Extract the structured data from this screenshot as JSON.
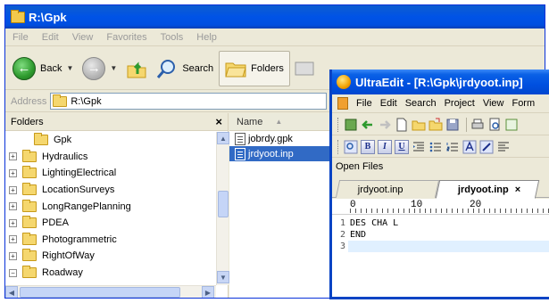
{
  "explorer": {
    "title": "R:\\Gpk",
    "menu": [
      "File",
      "Edit",
      "View",
      "Favorites",
      "Tools",
      "Help"
    ],
    "toolbar": {
      "back_label": "Back",
      "search_label": "Search",
      "folders_label": "Folders"
    },
    "address": {
      "label": "Address",
      "value": "R:\\Gpk"
    },
    "folders_pane": {
      "title": "Folders",
      "close": "×",
      "items": [
        {
          "label": "Gpk",
          "expander": ""
        },
        {
          "label": "Hydraulics",
          "expander": "+"
        },
        {
          "label": "LightingElectrical",
          "expander": "+"
        },
        {
          "label": "LocationSurveys",
          "expander": "+"
        },
        {
          "label": "LongRangePlanning",
          "expander": "+"
        },
        {
          "label": "PDEA",
          "expander": "+"
        },
        {
          "label": "Photogrammetric",
          "expander": "+"
        },
        {
          "label": "RightOfWay",
          "expander": "+"
        },
        {
          "label": "Roadway",
          "expander": "−"
        }
      ]
    },
    "file_list": {
      "column_name": "Name",
      "sort_indicator": "▲",
      "files": [
        {
          "name": "jobrdy.gpk",
          "selected": false
        },
        {
          "name": "jrdyoot.inp",
          "selected": true
        }
      ]
    }
  },
  "ultraedit": {
    "title": "UltraEdit - [R:\\Gpk\\jrdyoot.inp]",
    "menu": [
      "File",
      "Edit",
      "Search",
      "Project",
      "View",
      "Form"
    ],
    "format_buttons": [
      "B",
      "I",
      "U"
    ],
    "open_files_label": "Open Files",
    "tabs": [
      {
        "label": "jrdyoot.inp",
        "active": false
      },
      {
        "label": "jrdyoot.inp",
        "active": true,
        "close": "×"
      }
    ],
    "ruler": [
      "0",
      "10",
      "20"
    ],
    "lines": [
      {
        "num": "1",
        "text": "DES CHA L"
      },
      {
        "num": "2",
        "text": "END"
      },
      {
        "num": "3",
        "text": ""
      }
    ]
  }
}
